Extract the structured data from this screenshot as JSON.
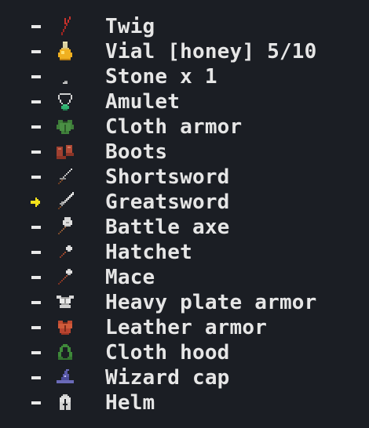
{
  "inventory": {
    "items": [
      {
        "label": "Twig",
        "icon": "twig-icon",
        "marker": "dash"
      },
      {
        "label": "Vial [honey] 5/10",
        "icon": "honey-vial-icon",
        "marker": "dash"
      },
      {
        "label": "Stone x 1",
        "icon": "stone-icon",
        "marker": "dash"
      },
      {
        "label": "Amulet",
        "icon": "amulet-icon",
        "marker": "dash"
      },
      {
        "label": "Cloth armor",
        "icon": "cloth-armor-icon",
        "marker": "dash"
      },
      {
        "label": "Boots",
        "icon": "boots-icon",
        "marker": "dash"
      },
      {
        "label": "Shortsword",
        "icon": "shortsword-icon",
        "marker": "dash"
      },
      {
        "label": "Greatsword",
        "icon": "greatsword-icon",
        "marker": "arrow"
      },
      {
        "label": "Battle axe",
        "icon": "battle-axe-icon",
        "marker": "dash"
      },
      {
        "label": "Hatchet",
        "icon": "hatchet-icon",
        "marker": "dash"
      },
      {
        "label": "Mace",
        "icon": "mace-icon",
        "marker": "dash"
      },
      {
        "label": "Heavy plate armor",
        "icon": "plate-armor-icon",
        "marker": "dash"
      },
      {
        "label": "Leather armor",
        "icon": "leather-armor-icon",
        "marker": "dash"
      },
      {
        "label": "Cloth hood",
        "icon": "cloth-hood-icon",
        "marker": "dash"
      },
      {
        "label": "Wizard cap",
        "icon": "wizard-cap-icon",
        "marker": "dash"
      },
      {
        "label": "Helm",
        "icon": "helm-icon",
        "marker": "dash"
      }
    ]
  },
  "colors": {
    "background": "#1b1e24",
    "text": "#e6e6e6",
    "selection_arrow": "#f5e21b"
  }
}
